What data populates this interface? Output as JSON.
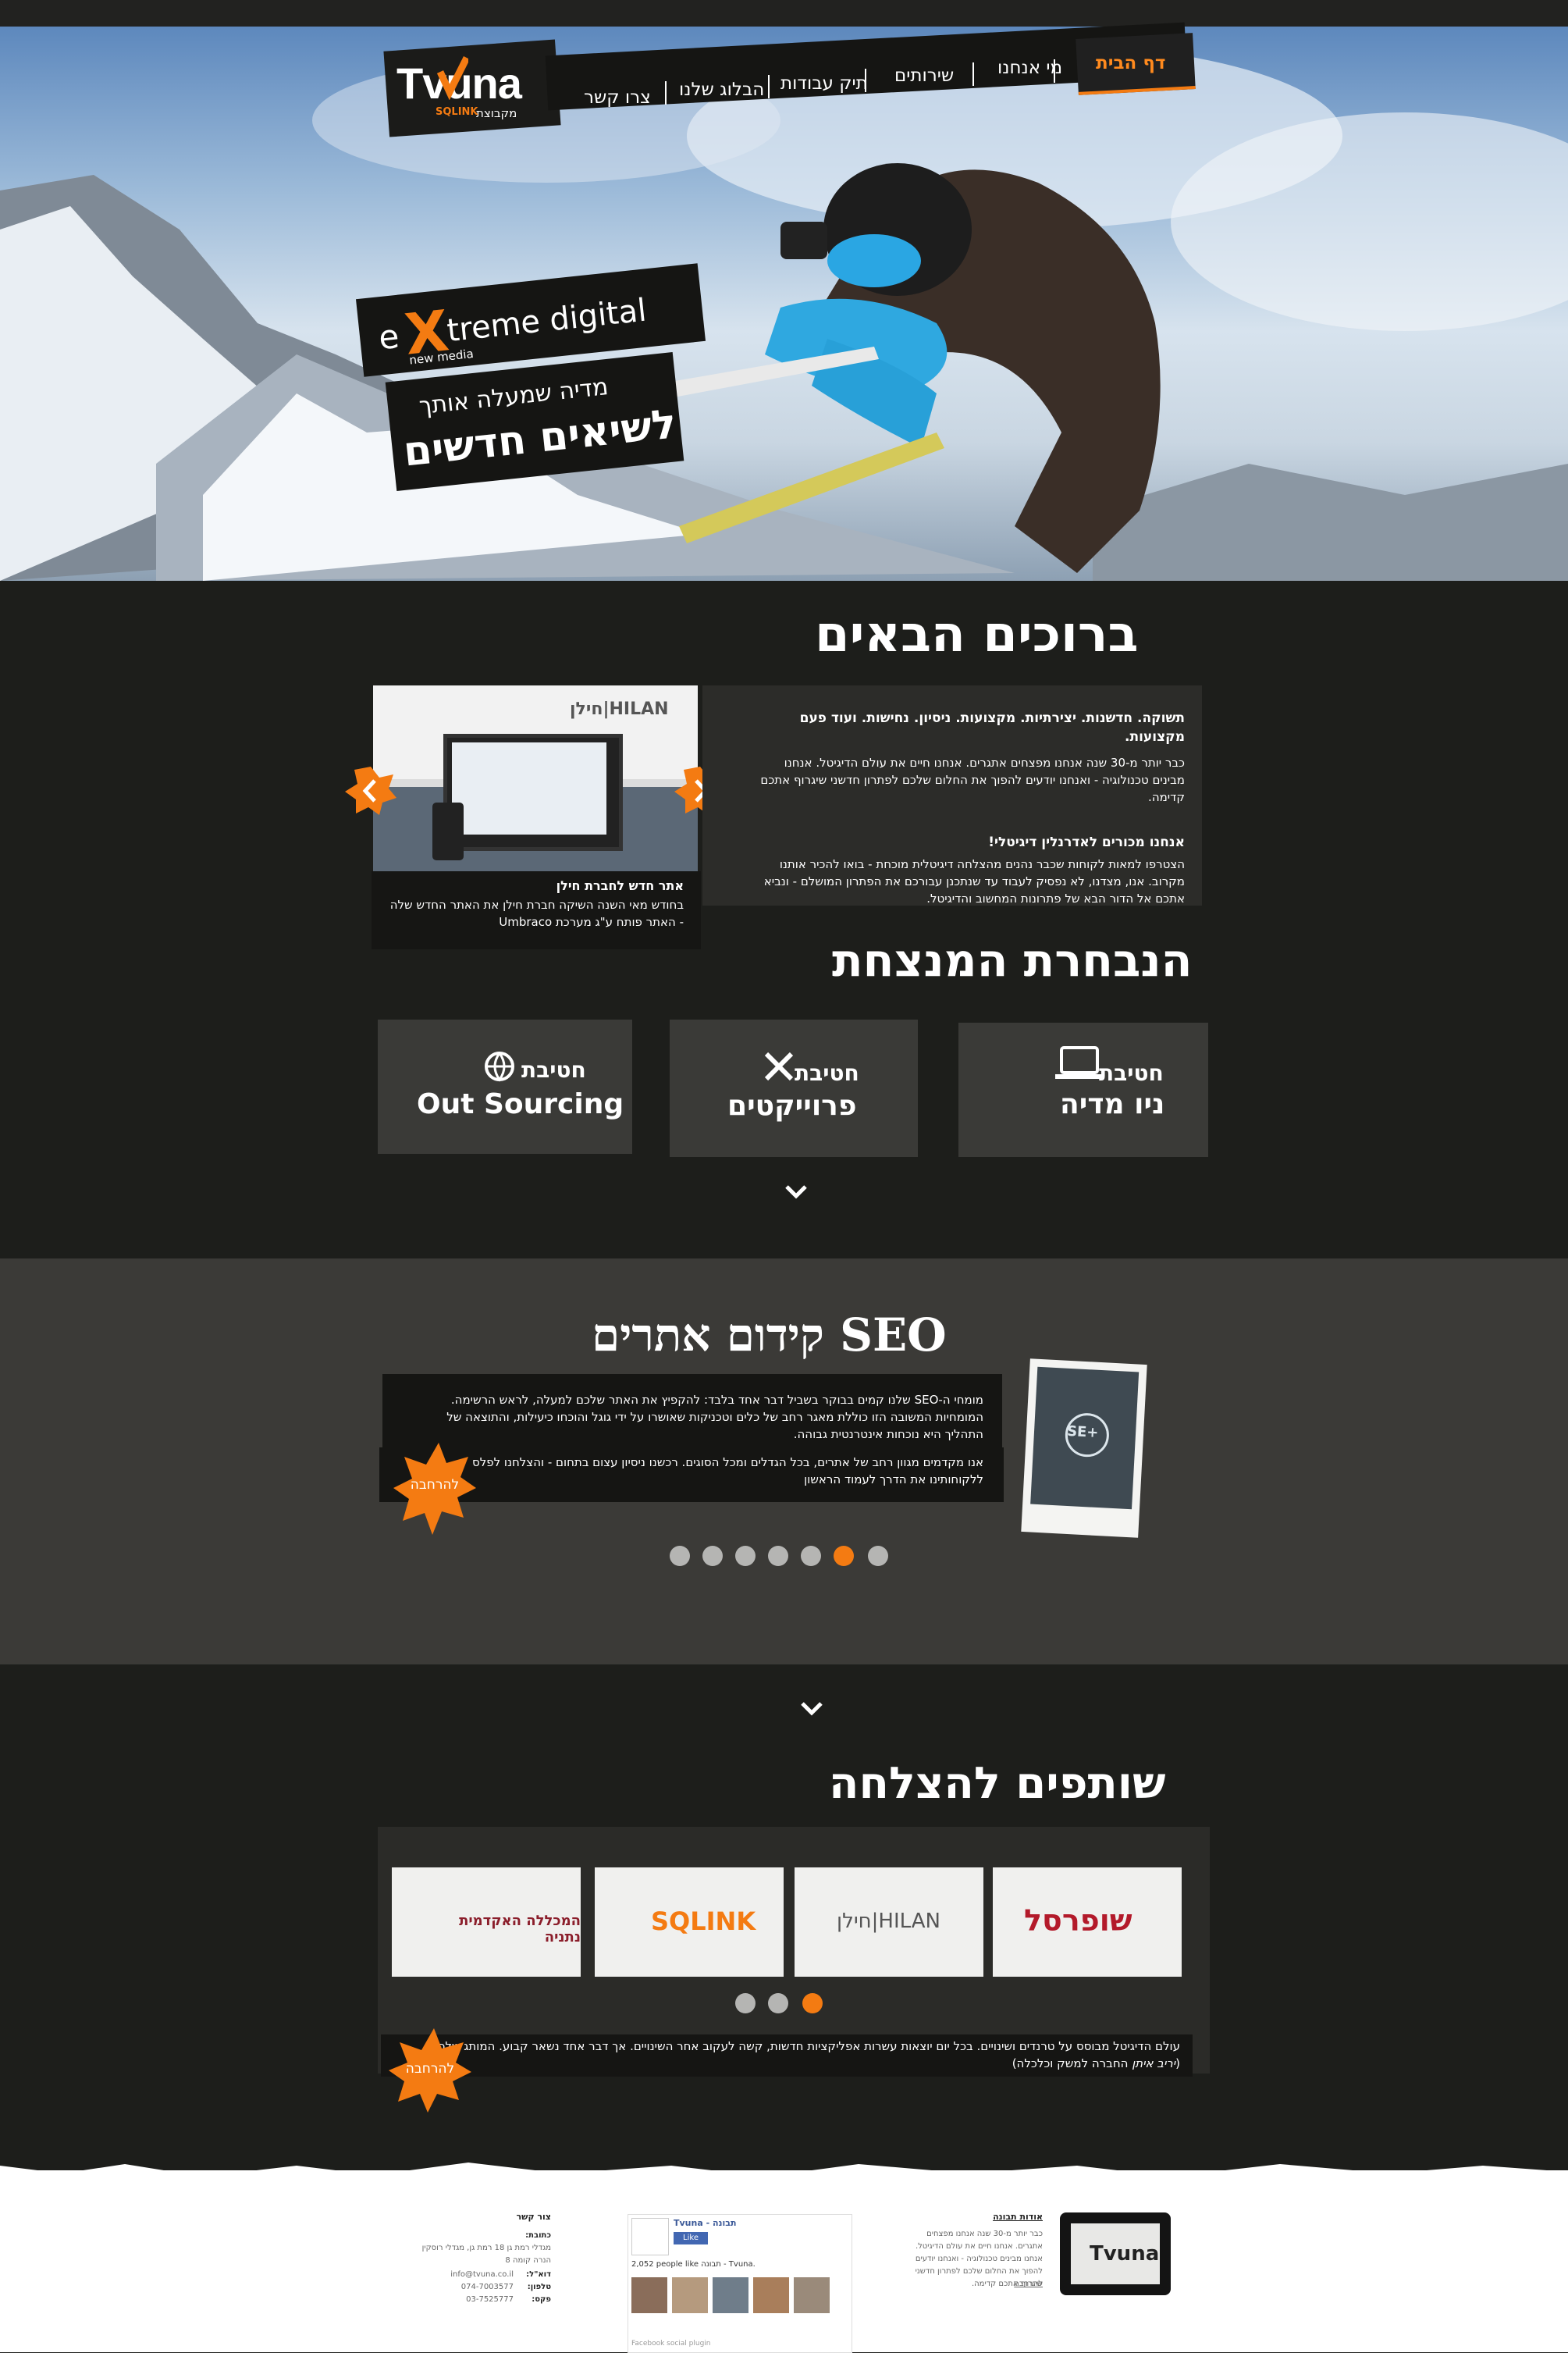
{
  "nav": {
    "logo_text": "Tvuna",
    "logo_sub": "מקבוצת",
    "logo_group": "SQLINK",
    "items": [
      {
        "label": "דף הבית"
      },
      {
        "label": "מי אנחנו"
      },
      {
        "label": "שירותים"
      },
      {
        "label": "תיק עבודות"
      },
      {
        "label": "הבלוג שלנו"
      },
      {
        "label": "צרו קשר"
      }
    ]
  },
  "hero": {
    "brand_e": "e",
    "brand_x": "X",
    "brand_rest": "treme digital",
    "brand_sub": "new media",
    "slogan_line1": "מדיה שמעלה אותך",
    "slogan_line2": "לשיאים חדשים"
  },
  "welcome": {
    "title": "ברוכים הבאים",
    "p1_bold": "תשוקה. חדשנות. יצירתיות. מקצועות. ניסיון. נחישות. ועוד פעם מקצועות.",
    "p1": "כבר יותר מ-30 שנה אנחנו מפצחים אתגרים. אנחנו חיים את עולם הדיגיטל. אנחנו מבינים טכנולוגיה - ואנחנו יודעים להפוך את החלום שלכם לפתרון חדשני שיגרוף אתכם קדימה.",
    "p2_bold": "אנחנו מכורים לאדרנלין דיגיטלי!",
    "p2": "הצטרפו למאות לקוחות שכבר נהנים מהצלחה דיגיטלית מוכחת - בואו להכיר אותנו מקרוב. אנו, מצדנו, לא נפסיק לעבוד עד שנתכנן עבורכם את הפתרון המושלם - ונביא אתכם אל הדור הבא של פתרונות המחשוב והדיגיטל.",
    "slide_caption_title": "אתר חדש לחברת חילן",
    "slide_caption": "בחודש מאי השנה השיקה חברת חילן את האתר החדש שלה - האתר פותח ע\"ג מערכת Umbraco",
    "slide_logo": "חילן|HILAN"
  },
  "divisions": {
    "title": "הנבחרת המנצחת",
    "items": [
      {
        "prefix": "חטיבת",
        "name": "ניו מדיה"
      },
      {
        "prefix": "חטיבת",
        "name": "פרוייקטים"
      },
      {
        "prefix": "חטיבת",
        "name": "Out Sourcing"
      }
    ]
  },
  "seo": {
    "title": "SEO קידום אתרים",
    "p1": "מומחי ה-SEO שלנו קמים בבוקר בשביל דבר אחד בלבד: להקפיץ את האתר שלכם למעלה, לראש הרשימה. המומחיות המשובה הזו כוללת מאגר רחב של כלים וטכניקות שאושרו על ידי גוגל והוכחו כיעילות, והתוצאה של התהליך היא נוכחות אינטרנטית גבוהה.",
    "p2": "אנו מקדמים מגוון רחב של אתרים, בכל הגדלים ומכל הסוגים. רכשנו ניסיון עצום בתחום - והצלחנו לפלס ללקוחותינו את הדרך לעמוד הראשון",
    "more": "להרחבה",
    "photo_label": "SE+"
  },
  "partners": {
    "title": "שותפים להצלחה",
    "logos": [
      {
        "name": "שופרסל"
      },
      {
        "name": "חילן|HILAN"
      },
      {
        "name": "SQLINK"
      },
      {
        "name": "המכללה האקדמית נתניה"
      }
    ],
    "text_before": "עולם הדיגיטל מבוסס על טרנדים ושינויים. בכל יום יוצאות עשרות אפליקציות חדשות, קשה לעקוב אחר השינויים. אך דבר אחד נשאר קבוע. המותג שלכם (",
    "text_em": "יריב איתן",
    "text_after": " החברה למשק וכלכלה)",
    "more": "להרחבה"
  },
  "footer": {
    "about_title": "אודות תבונה",
    "about_text": "כבר יותר מ-30 שנה אנחנו מפצחים אתגרים. אנחנו חיים את עולם הדיגיטל. אנחנו מבינים טכנולוגיה - ואנחנו יודעים להפוך את החלום שלכם לפתרון חדשני שיגרוף אתכם קדימה.",
    "about_more": "להרחבה",
    "fb_name": "Tvuna - תבונה",
    "fb_like": "Like",
    "fb_count": "2,052 people like תבונה - Tvuna.",
    "fb_plugin": "Facebook social plugin",
    "contact_title": "צור קשר",
    "contact_address_label": "כתובת:",
    "contact_address": "מגדלי רמת גן 18 רמת גן, מגדלי רוסקין הנרה קומה 8",
    "contact_email_label": "דוא\"ל:",
    "contact_email": "info@tvuna.co.il",
    "contact_phone_label": "טלפון:",
    "contact_phone": "074-7003577",
    "contact_fax_label": "פקס:",
    "contact_fax": "03-7525777"
  }
}
